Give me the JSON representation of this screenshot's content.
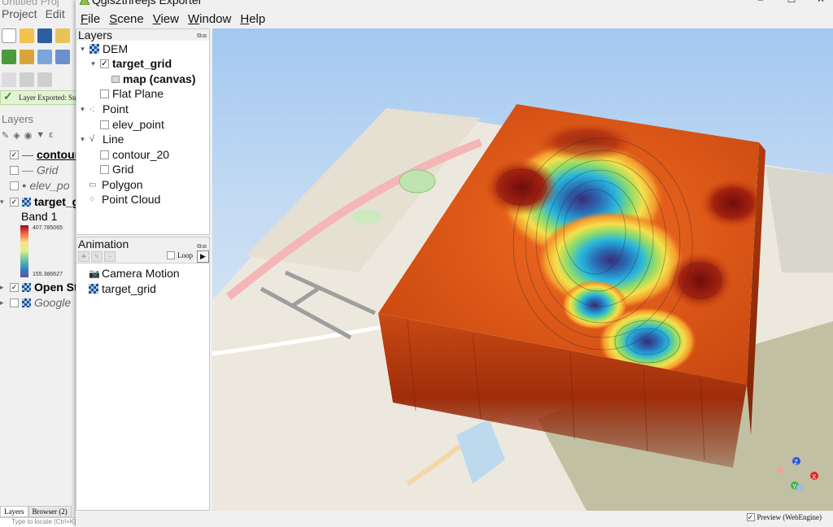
{
  "qgis": {
    "window_title": "Untitled Proj",
    "menu": [
      "Project",
      "Edit"
    ],
    "status_message": "Layer Exported: Suc",
    "layers_title": "Layers",
    "layers": [
      {
        "label": "contour",
        "style": "bold-underline",
        "checked": true,
        "icon": "line-icon"
      },
      {
        "label": "Grid",
        "style": "italic",
        "checked": false,
        "icon": "line-icon"
      },
      {
        "label": "elev_po",
        "style": "italic",
        "checked": false,
        "icon": "point-icon"
      },
      {
        "label": "target_g",
        "style": "bold",
        "checked": true,
        "icon": "raster-icon"
      },
      {
        "label": "Open St",
        "style": "bold",
        "checked": true,
        "icon": "raster-icon"
      },
      {
        "label": "Google",
        "style": "italic",
        "checked": false,
        "icon": "raster-icon"
      }
    ],
    "band_label": "Band 1",
    "legend_max": "407.785065",
    "legend_min": "155.386627",
    "bottom_tabs": [
      "Layers",
      "Browser (2)"
    ],
    "locate_placeholder": "Type to locate (Ctrl+K)"
  },
  "exporter": {
    "title": "Qgis2threejs Exporter",
    "menu": [
      {
        "label": "File",
        "mnemonic": "F",
        "rest": "ile"
      },
      {
        "label": "Scene",
        "mnemonic": "S",
        "rest": "cene"
      },
      {
        "label": "View",
        "mnemonic": "V",
        "rest": "iew"
      },
      {
        "label": "Window",
        "mnemonic": "W",
        "rest": "indow"
      },
      {
        "label": "Help",
        "mnemonic": "H",
        "rest": "elp"
      }
    ],
    "layers_panel": {
      "title": "Layers",
      "groups": {
        "dem": "DEM",
        "target_grid": "target_grid",
        "map_canvas": "map (canvas)",
        "flat_plane": "Flat Plane",
        "point": "Point",
        "elev_point": "elev_point",
        "line": "Line",
        "contour_20": "contour_20",
        "grid": "Grid",
        "polygon": "Polygon",
        "point_cloud": "Point Cloud"
      }
    },
    "animation_panel": {
      "title": "Animation",
      "loop_label": "Loop",
      "items": [
        "Camera Motion",
        "target_grid"
      ]
    },
    "preview_label": "Preview (WebEngine)",
    "preview_checked": true,
    "axis_labels": {
      "x": "X",
      "y": "Y",
      "z": "Z"
    }
  }
}
